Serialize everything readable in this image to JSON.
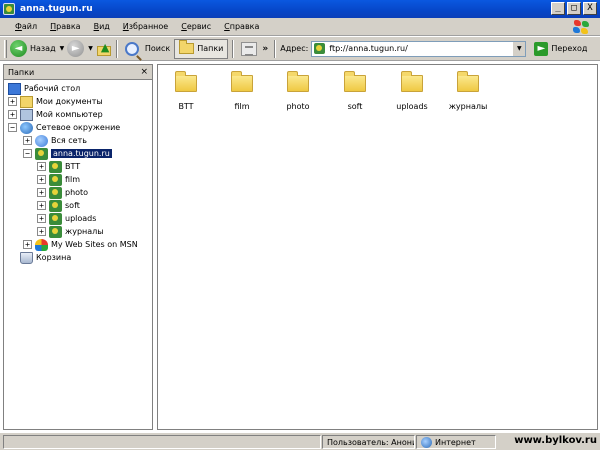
{
  "window": {
    "title": "anna.tugun.ru",
    "min": "_",
    "max": "□",
    "close": "X"
  },
  "menu": [
    "Файл",
    "Правка",
    "Вид",
    "Избранное",
    "Сервис",
    "Справка"
  ],
  "toolbar": {
    "back_label": "Назад",
    "back_arrow": "◄",
    "forward_arrow": "►",
    "up_arrow": "▲",
    "search_label": "Поиск",
    "folders_label": "Папки",
    "more": "»",
    "dropdown": "▼",
    "address_label": "Адрес:",
    "address_value": "ftp://anna.tugun.ru/",
    "go_label": "Переход",
    "go_arrow": "►"
  },
  "left_pane": {
    "title": "Папки",
    "close": "×",
    "tree": [
      {
        "label": "Рабочий стол",
        "icon": "desktop-icon",
        "pm": ""
      },
      {
        "label": "Мои документы",
        "icon": "documents-folder-icon",
        "pm": "+"
      },
      {
        "label": "Мой компьютер",
        "icon": "computer-icon",
        "pm": "+"
      },
      {
        "label": "Сетевое окружение",
        "icon": "network-icon",
        "pm": "−"
      },
      {
        "label": "Вся сеть",
        "icon": "globe-icon",
        "pm": "+"
      },
      {
        "label": "anna.tugun.ru",
        "icon": "ftp-site-icon",
        "pm": "−",
        "selected": true
      },
      {
        "label": "BTT",
        "icon": "ftp-folder-icon",
        "pm": "+"
      },
      {
        "label": "film",
        "icon": "ftp-folder-icon",
        "pm": "+"
      },
      {
        "label": "photo",
        "icon": "ftp-folder-icon",
        "pm": "+"
      },
      {
        "label": "soft",
        "icon": "ftp-folder-icon",
        "pm": "+"
      },
      {
        "label": "uploads",
        "icon": "ftp-folder-icon",
        "pm": "+"
      },
      {
        "label": "журналы",
        "icon": "ftp-folder-icon",
        "pm": "+"
      },
      {
        "label": "My Web Sites on MSN",
        "icon": "msn-icon",
        "pm": "+"
      },
      {
        "label": "Корзина",
        "icon": "recycle-bin-icon",
        "pm": ""
      }
    ]
  },
  "folders": [
    {
      "name": "BTT"
    },
    {
      "name": "film"
    },
    {
      "name": "photo"
    },
    {
      "name": "soft"
    },
    {
      "name": "uploads"
    },
    {
      "name": "журналы"
    }
  ],
  "status": {
    "user": "Пользователь: Аноним",
    "zone": "Интернет",
    "watermark": "www.bylkov.ru"
  },
  "colors": {
    "title_bar": "#0a58e0",
    "selection": "#0a246a",
    "chrome": "#d4d0c8"
  }
}
